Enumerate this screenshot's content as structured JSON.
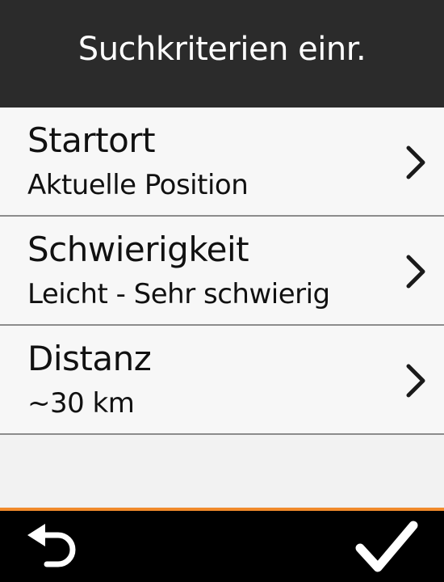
{
  "header": {
    "title": "Suchkriterien einr."
  },
  "criteria": [
    {
      "label": "Startort",
      "value": "Aktuelle Position"
    },
    {
      "label": "Schwierigkeit",
      "value": "Leicht - Sehr schwierig"
    },
    {
      "label": "Distanz",
      "value": "~30 km"
    }
  ],
  "icons": {
    "row_chevron": "chevron-right-icon",
    "back": "back-arrow-icon",
    "confirm": "checkmark-icon"
  },
  "colors": {
    "header_bg": "#2b2b2b",
    "list_bg": "#f7f7f7",
    "divider": "#8c8c8c",
    "accent": "#f08a2b",
    "footer_bg": "#000000"
  }
}
